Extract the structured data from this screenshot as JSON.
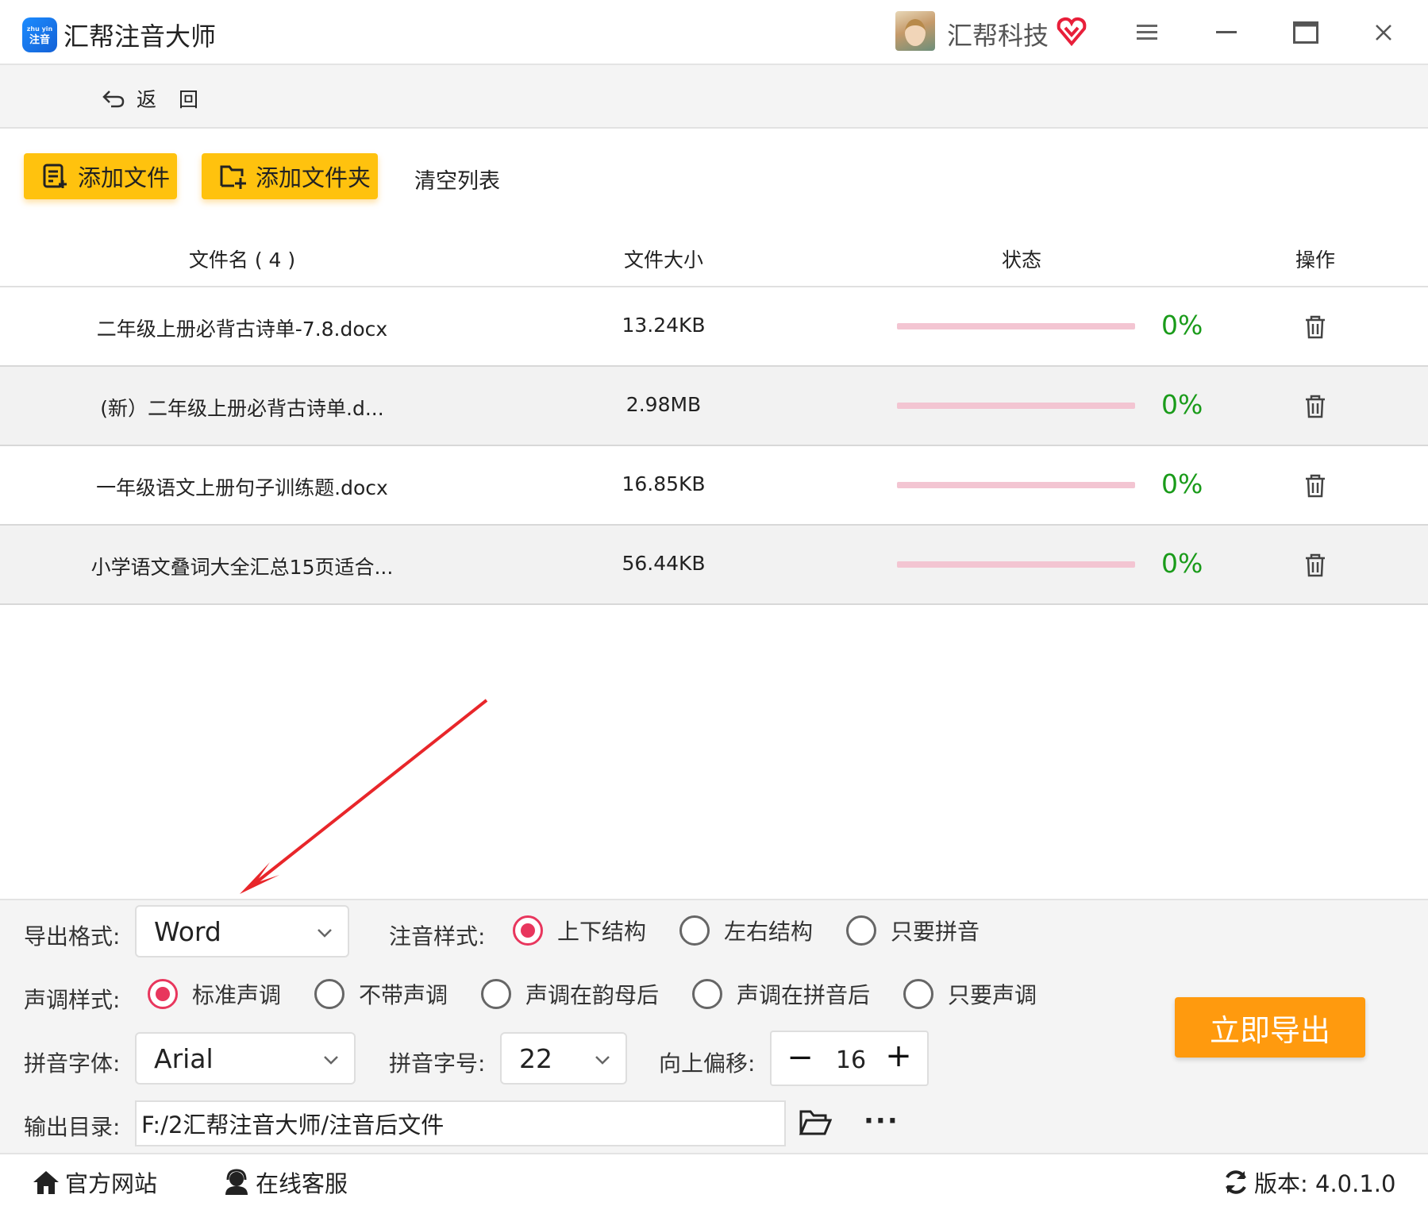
{
  "app": {
    "title": "汇帮注音大师",
    "logo_text": "注音",
    "logo_sub": "zhu yin",
    "user_name": "汇帮科技"
  },
  "nav": {
    "back_label": "返 回"
  },
  "toolbar": {
    "add_file": "添加文件",
    "add_folder": "添加文件夹",
    "clear_list": "清空列表"
  },
  "table": {
    "headers": {
      "name": "文件名 ( 4 )",
      "size": "文件大小",
      "status": "状态",
      "action": "操作"
    },
    "rows": [
      {
        "name": "二年级上册必背古诗单-7.8.docx",
        "size": "13.24KB",
        "percent": "0%",
        "progress": 0
      },
      {
        "name": "(新）二年级上册必背古诗单.d...",
        "size": "2.98MB",
        "percent": "0%",
        "progress": 0
      },
      {
        "name": "一年级语文上册句子训练题.docx",
        "size": "16.85KB",
        "percent": "0%",
        "progress": 0
      },
      {
        "name": "小学语文叠词大全汇总15页适合...",
        "size": "56.44KB",
        "percent": "0%",
        "progress": 0
      }
    ]
  },
  "settings": {
    "export_format_label": "导出格式:",
    "export_format_value": "Word",
    "annotation_style_label": "注音样式:",
    "annotation_options": [
      "上下结构",
      "左右结构",
      "只要拼音"
    ],
    "annotation_selected": "上下结构",
    "tone_style_label": "声调样式:",
    "tone_options": [
      "标准声调",
      "不带声调",
      "声调在韵母后",
      "声调在拼音后",
      "只要声调"
    ],
    "tone_selected": "标准声调",
    "pinyin_font_label": "拼音字体:",
    "pinyin_font_value": "Arial",
    "pinyin_size_label": "拼音字号:",
    "pinyin_size_value": "22",
    "offset_label": "向上偏移:",
    "offset_value": "16",
    "output_dir_label": "输出目录:",
    "output_dir_value": "F:/2汇帮注音大师/注音后文件",
    "export_button": "立即导出"
  },
  "footer": {
    "website": "官方网站",
    "service": "在线客服",
    "version": "版本:  4.0.1.0"
  },
  "colors": {
    "accent_yellow": "#ffc20e",
    "export_orange": "#ff9a0e",
    "radio_red": "#e8365d",
    "percent_green": "#1a9b1a",
    "progress_track": "#f3c5d2",
    "annotation_arrow": "#e8262a"
  }
}
